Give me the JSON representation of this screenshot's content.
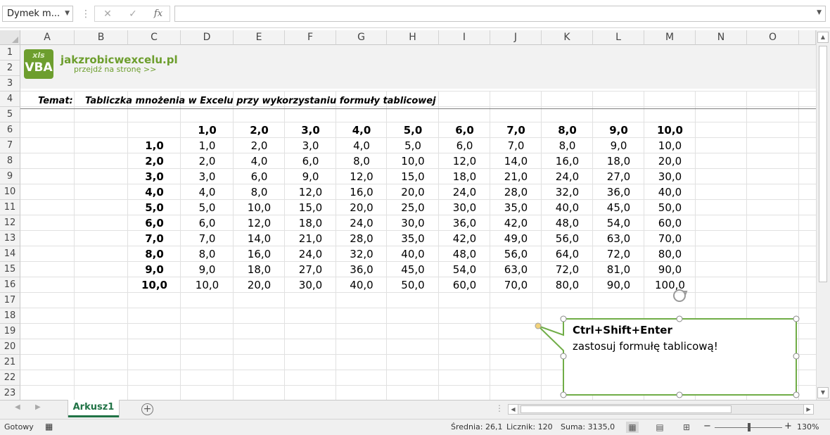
{
  "formula_bar": {
    "name_box": "Dymek m...",
    "cancel_symbol": "✕",
    "enter_symbol": "✓",
    "fx_label": "fx",
    "formula_value": ""
  },
  "columns": [
    "A",
    "B",
    "C",
    "D",
    "E",
    "F",
    "G",
    "H",
    "I",
    "J",
    "K",
    "L",
    "M",
    "N",
    "O"
  ],
  "rows": [
    "1",
    "2",
    "3",
    "4",
    "5",
    "6",
    "7",
    "8",
    "9",
    "10",
    "11",
    "12",
    "13",
    "14",
    "15",
    "16",
    "17",
    "18",
    "19",
    "20",
    "21",
    "22",
    "23"
  ],
  "logo": {
    "badge_top": "xls",
    "badge_bottom": "VBA",
    "site": "jakzrobicwexcelu.pl",
    "link": "przejdź na stronę >>"
  },
  "topic": {
    "label": "Temat:",
    "text": "Tabliczka mnożenia w Excelu przy wykorzystaniu formuły tablicowej"
  },
  "table": {
    "col_headers": [
      "1,0",
      "2,0",
      "3,0",
      "4,0",
      "5,0",
      "6,0",
      "7,0",
      "8,0",
      "9,0",
      "10,0"
    ],
    "row_headers": [
      "1,0",
      "2,0",
      "3,0",
      "4,0",
      "5,0",
      "6,0",
      "7,0",
      "8,0",
      "9,0",
      "10,0"
    ],
    "values": [
      [
        "1,0",
        "2,0",
        "3,0",
        "4,0",
        "5,0",
        "6,0",
        "7,0",
        "8,0",
        "9,0",
        "10,0"
      ],
      [
        "2,0",
        "4,0",
        "6,0",
        "8,0",
        "10,0",
        "12,0",
        "14,0",
        "16,0",
        "18,0",
        "20,0"
      ],
      [
        "3,0",
        "6,0",
        "9,0",
        "12,0",
        "15,0",
        "18,0",
        "21,0",
        "24,0",
        "27,0",
        "30,0"
      ],
      [
        "4,0",
        "8,0",
        "12,0",
        "16,0",
        "20,0",
        "24,0",
        "28,0",
        "32,0",
        "36,0",
        "40,0"
      ],
      [
        "5,0",
        "10,0",
        "15,0",
        "20,0",
        "25,0",
        "30,0",
        "35,0",
        "40,0",
        "45,0",
        "50,0"
      ],
      [
        "6,0",
        "12,0",
        "18,0",
        "24,0",
        "30,0",
        "36,0",
        "42,0",
        "48,0",
        "54,0",
        "60,0"
      ],
      [
        "7,0",
        "14,0",
        "21,0",
        "28,0",
        "35,0",
        "42,0",
        "49,0",
        "56,0",
        "63,0",
        "70,0"
      ],
      [
        "8,0",
        "16,0",
        "24,0",
        "32,0",
        "40,0",
        "48,0",
        "56,0",
        "64,0",
        "72,0",
        "80,0"
      ],
      [
        "9,0",
        "18,0",
        "27,0",
        "36,0",
        "45,0",
        "54,0",
        "63,0",
        "72,0",
        "81,0",
        "90,0"
      ],
      [
        "10,0",
        "20,0",
        "30,0",
        "40,0",
        "50,0",
        "60,0",
        "70,0",
        "80,0",
        "90,0",
        "100,0"
      ]
    ]
  },
  "callout": {
    "title": "Ctrl+Shift+Enter",
    "body": "zastosuj formułę tablicową!",
    "border_color": "#70ad47"
  },
  "sheets": {
    "active": "Arkusz1",
    "add_symbol": "+"
  },
  "status_bar": {
    "mode": "Gotowy",
    "average": "Średnia: 26,1",
    "count": "Licznik: 120",
    "sum": "Suma: 3135,0",
    "zoom_minus": "−",
    "zoom_plus": "+",
    "zoom": "130%"
  },
  "colors": {
    "accent": "#217346",
    "logo_green": "#6d9e2e",
    "header_band": "#f2f2f2"
  }
}
